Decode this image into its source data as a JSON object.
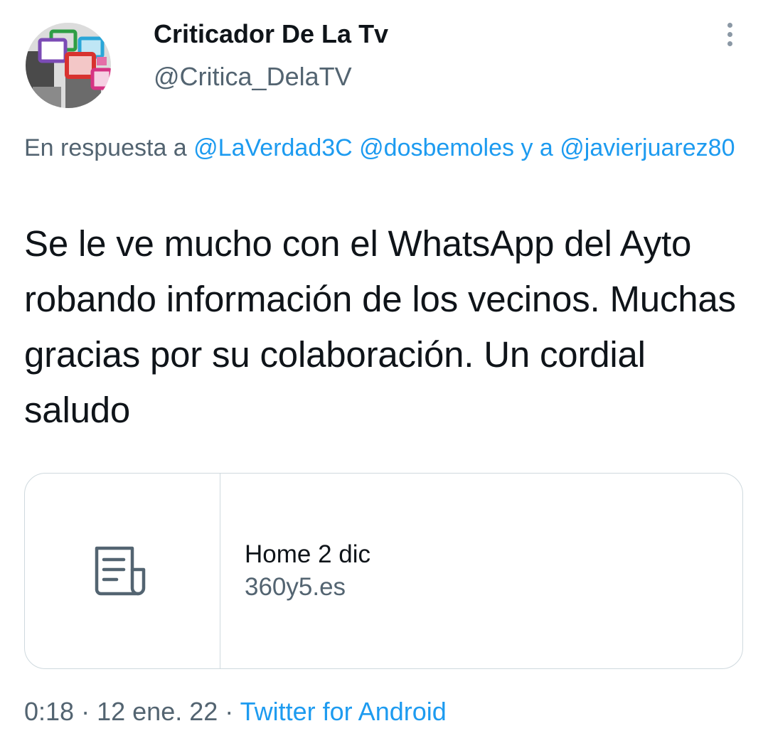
{
  "author": {
    "display_name": "Criticador De La Tv",
    "handle": "@Critica_DelaTV"
  },
  "reply": {
    "prefix": "En respuesta a",
    "mention_1": "@LaVerdad3C",
    "mention_2": "@dosbemoles",
    "connector": "y a",
    "mention_3": "@javierjuarez80"
  },
  "tweet": {
    "text": "Se le ve mucho con el WhatsApp del Ayto robando información de los vecinos. Muchas gracias por su colaboración. Un cordial saludo"
  },
  "link_card": {
    "title": "Home 2 dic",
    "domain": "360y5.es",
    "icon": "article-icon"
  },
  "meta": {
    "time": "0:18",
    "separator": "·",
    "date": "12 ene. 22",
    "source": "Twitter for Android"
  },
  "colors": {
    "link": "#1d9bf0",
    "secondary_text": "#536471",
    "primary_text": "#0f1419",
    "border": "#cfd9de"
  }
}
